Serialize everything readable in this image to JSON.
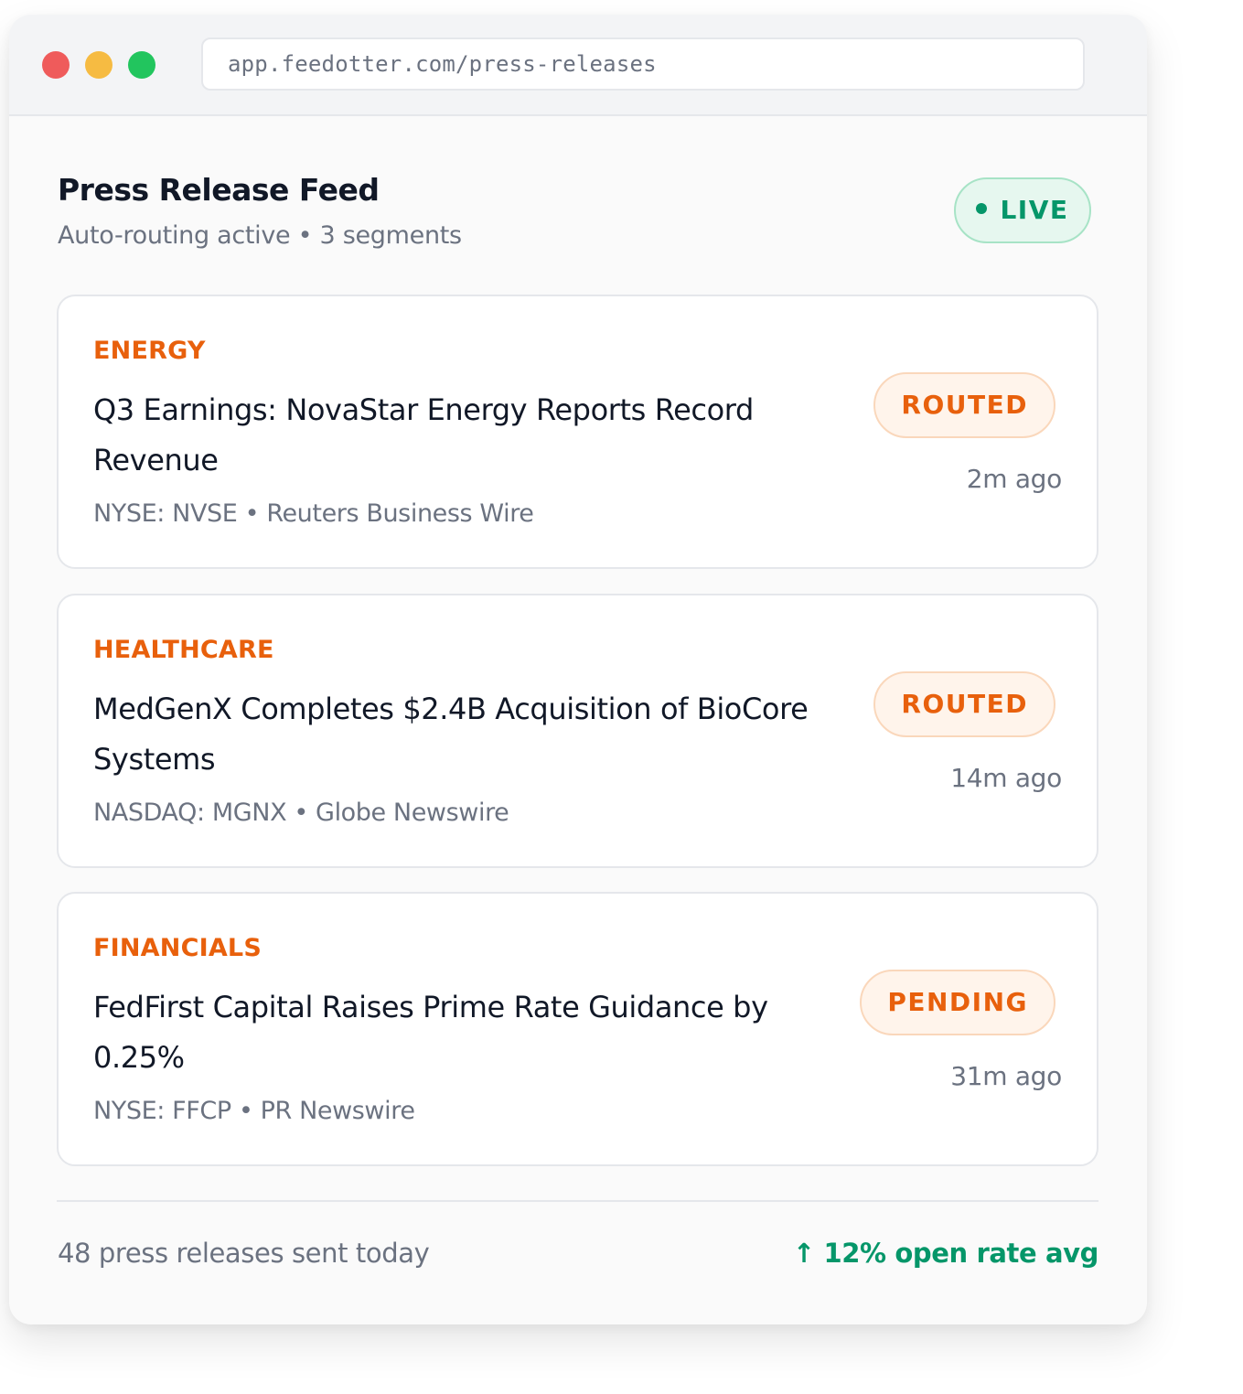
{
  "browser": {
    "url": "app.feedotter.com/press-releases"
  },
  "header": {
    "title": "Press Release Feed",
    "subtitle": "Auto-routing active • 3 segments",
    "live_label": "LIVE"
  },
  "colors": {
    "accent_orange": "#e8600c",
    "live_green": "#059669"
  },
  "releases": [
    {
      "category": "ENERGY",
      "headline": "Q3 Earnings: NovaStar Energy Reports Record Revenue",
      "meta": "NYSE: NVSE • Reuters Business Wire",
      "status": "ROUTED",
      "time": "2m ago"
    },
    {
      "category": "HEALTHCARE",
      "headline": "MedGenX Completes $2.4B Acquisition of BioCore Systems",
      "meta": "NASDAQ: MGNX • Globe Newswire",
      "status": "ROUTED",
      "time": "14m ago"
    },
    {
      "category": "FINANCIALS",
      "headline": "FedFirst Capital Raises Prime Rate Guidance by 0.25%",
      "meta": "NYSE: FFCP • PR Newswire",
      "status": "PENDING",
      "time": "31m ago"
    }
  ],
  "footer": {
    "sent_today": "48 press releases sent today",
    "open_rate": "↑ 12% open rate avg"
  }
}
